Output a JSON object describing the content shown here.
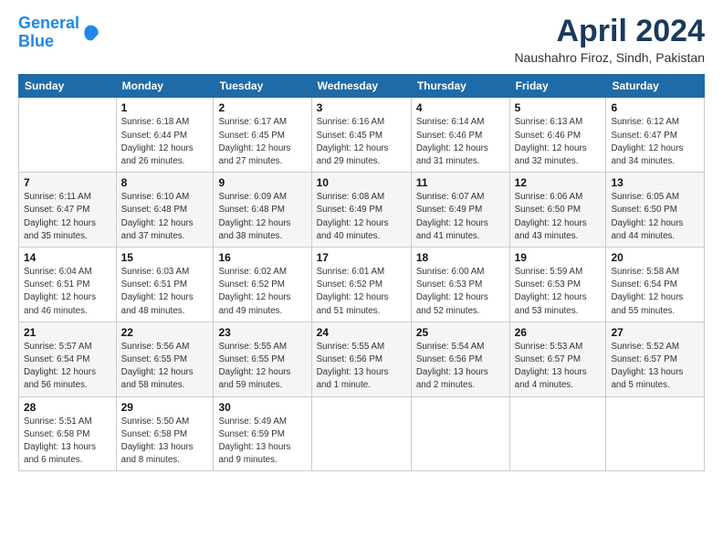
{
  "logo": {
    "line1": "General",
    "line2": "Blue"
  },
  "title": "April 2024",
  "subtitle": "Naushahro Firoz, Sindh, Pakistan",
  "header": {
    "days": [
      "Sunday",
      "Monday",
      "Tuesday",
      "Wednesday",
      "Thursday",
      "Friday",
      "Saturday"
    ]
  },
  "weeks": [
    [
      {
        "day": "",
        "info": ""
      },
      {
        "day": "1",
        "info": "Sunrise: 6:18 AM\nSunset: 6:44 PM\nDaylight: 12 hours\nand 26 minutes."
      },
      {
        "day": "2",
        "info": "Sunrise: 6:17 AM\nSunset: 6:45 PM\nDaylight: 12 hours\nand 27 minutes."
      },
      {
        "day": "3",
        "info": "Sunrise: 6:16 AM\nSunset: 6:45 PM\nDaylight: 12 hours\nand 29 minutes."
      },
      {
        "day": "4",
        "info": "Sunrise: 6:14 AM\nSunset: 6:46 PM\nDaylight: 12 hours\nand 31 minutes."
      },
      {
        "day": "5",
        "info": "Sunrise: 6:13 AM\nSunset: 6:46 PM\nDaylight: 12 hours\nand 32 minutes."
      },
      {
        "day": "6",
        "info": "Sunrise: 6:12 AM\nSunset: 6:47 PM\nDaylight: 12 hours\nand 34 minutes."
      }
    ],
    [
      {
        "day": "7",
        "info": "Sunrise: 6:11 AM\nSunset: 6:47 PM\nDaylight: 12 hours\nand 35 minutes."
      },
      {
        "day": "8",
        "info": "Sunrise: 6:10 AM\nSunset: 6:48 PM\nDaylight: 12 hours\nand 37 minutes."
      },
      {
        "day": "9",
        "info": "Sunrise: 6:09 AM\nSunset: 6:48 PM\nDaylight: 12 hours\nand 38 minutes."
      },
      {
        "day": "10",
        "info": "Sunrise: 6:08 AM\nSunset: 6:49 PM\nDaylight: 12 hours\nand 40 minutes."
      },
      {
        "day": "11",
        "info": "Sunrise: 6:07 AM\nSunset: 6:49 PM\nDaylight: 12 hours\nand 41 minutes."
      },
      {
        "day": "12",
        "info": "Sunrise: 6:06 AM\nSunset: 6:50 PM\nDaylight: 12 hours\nand 43 minutes."
      },
      {
        "day": "13",
        "info": "Sunrise: 6:05 AM\nSunset: 6:50 PM\nDaylight: 12 hours\nand 44 minutes."
      }
    ],
    [
      {
        "day": "14",
        "info": "Sunrise: 6:04 AM\nSunset: 6:51 PM\nDaylight: 12 hours\nand 46 minutes."
      },
      {
        "day": "15",
        "info": "Sunrise: 6:03 AM\nSunset: 6:51 PM\nDaylight: 12 hours\nand 48 minutes."
      },
      {
        "day": "16",
        "info": "Sunrise: 6:02 AM\nSunset: 6:52 PM\nDaylight: 12 hours\nand 49 minutes."
      },
      {
        "day": "17",
        "info": "Sunrise: 6:01 AM\nSunset: 6:52 PM\nDaylight: 12 hours\nand 51 minutes."
      },
      {
        "day": "18",
        "info": "Sunrise: 6:00 AM\nSunset: 6:53 PM\nDaylight: 12 hours\nand 52 minutes."
      },
      {
        "day": "19",
        "info": "Sunrise: 5:59 AM\nSunset: 6:53 PM\nDaylight: 12 hours\nand 53 minutes."
      },
      {
        "day": "20",
        "info": "Sunrise: 5:58 AM\nSunset: 6:54 PM\nDaylight: 12 hours\nand 55 minutes."
      }
    ],
    [
      {
        "day": "21",
        "info": "Sunrise: 5:57 AM\nSunset: 6:54 PM\nDaylight: 12 hours\nand 56 minutes."
      },
      {
        "day": "22",
        "info": "Sunrise: 5:56 AM\nSunset: 6:55 PM\nDaylight: 12 hours\nand 58 minutes."
      },
      {
        "day": "23",
        "info": "Sunrise: 5:55 AM\nSunset: 6:55 PM\nDaylight: 12 hours\nand 59 minutes."
      },
      {
        "day": "24",
        "info": "Sunrise: 5:55 AM\nSunset: 6:56 PM\nDaylight: 13 hours\nand 1 minute."
      },
      {
        "day": "25",
        "info": "Sunrise: 5:54 AM\nSunset: 6:56 PM\nDaylight: 13 hours\nand 2 minutes."
      },
      {
        "day": "26",
        "info": "Sunrise: 5:53 AM\nSunset: 6:57 PM\nDaylight: 13 hours\nand 4 minutes."
      },
      {
        "day": "27",
        "info": "Sunrise: 5:52 AM\nSunset: 6:57 PM\nDaylight: 13 hours\nand 5 minutes."
      }
    ],
    [
      {
        "day": "28",
        "info": "Sunrise: 5:51 AM\nSunset: 6:58 PM\nDaylight: 13 hours\nand 6 minutes."
      },
      {
        "day": "29",
        "info": "Sunrise: 5:50 AM\nSunset: 6:58 PM\nDaylight: 13 hours\nand 8 minutes."
      },
      {
        "day": "30",
        "info": "Sunrise: 5:49 AM\nSunset: 6:59 PM\nDaylight: 13 hours\nand 9 minutes."
      },
      {
        "day": "",
        "info": ""
      },
      {
        "day": "",
        "info": ""
      },
      {
        "day": "",
        "info": ""
      },
      {
        "day": "",
        "info": ""
      }
    ]
  ]
}
